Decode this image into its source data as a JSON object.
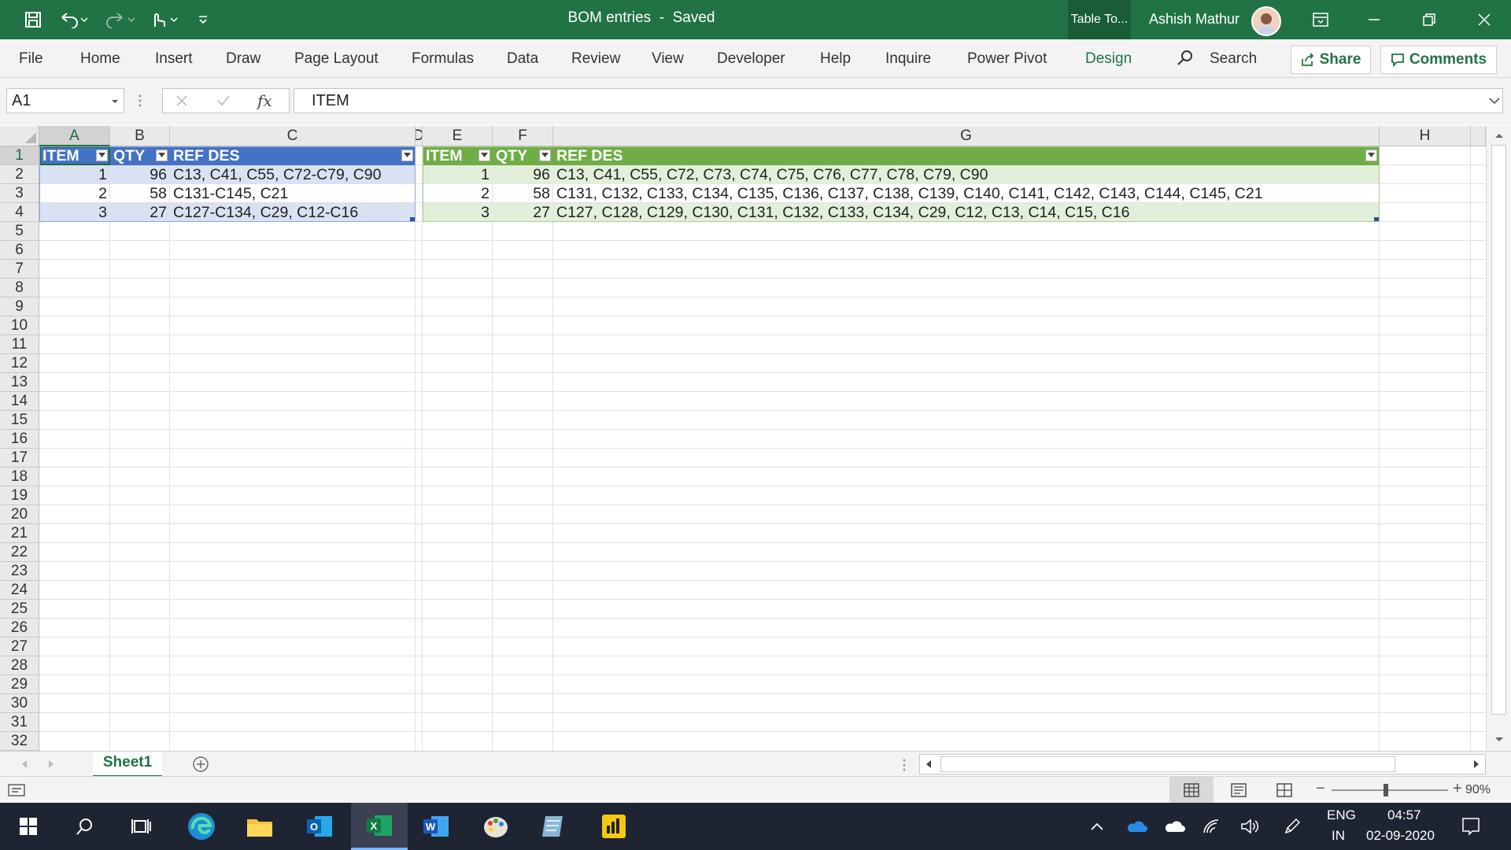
{
  "titlebar": {
    "doc_title": "BOM entries  -  Saved",
    "table_tools": "Table To...",
    "user_name": "Ashish Mathur"
  },
  "ribbon": {
    "tabs": [
      "File",
      "Home",
      "Insert",
      "Draw",
      "Page Layout",
      "Formulas",
      "Data",
      "Review",
      "View",
      "Developer",
      "Help",
      "Inquire",
      "Power Pivot",
      "Design"
    ],
    "search_label": "Search",
    "share_label": "Share",
    "comments_label": "Comments"
  },
  "formula_bar": {
    "name_box": "A1",
    "formula": "ITEM"
  },
  "columns": [
    "A",
    "B",
    "C",
    "D",
    "E",
    "F",
    "G",
    "H"
  ],
  "rows": [
    "1",
    "2",
    "3",
    "4",
    "5",
    "6",
    "7",
    "8",
    "9",
    "10",
    "11",
    "12",
    "13",
    "14",
    "15",
    "16",
    "17",
    "18",
    "19",
    "20",
    "21",
    "22",
    "23",
    "24",
    "25",
    "26",
    "27",
    "28",
    "29",
    "30",
    "31",
    "32"
  ],
  "table1": {
    "headers": [
      "ITEM",
      "QTY",
      "REF DES"
    ],
    "rows": [
      [
        "1",
        "96",
        "C13, C41, C55, C72-C79, C90"
      ],
      [
        "2",
        "58",
        "C131-C145, C21"
      ],
      [
        "3",
        "27",
        "C127-C134, C29, C12-C16"
      ]
    ]
  },
  "table2": {
    "headers": [
      "ITEM",
      "QTY",
      "REF DES"
    ],
    "rows": [
      [
        "1",
        "96",
        "C13, C41, C55, C72, C73, C74, C75, C76, C77, C78, C79, C90"
      ],
      [
        "2",
        "58",
        "C131, C132, C133, C134, C135, C136, C137, C138, C139, C140, C141, C142, C143, C144, C145, C21"
      ],
      [
        "3",
        "27",
        "C127, C128, C129, C130, C131, C132, C133, C134, C29, C12, C13, C14, C15, C16"
      ]
    ]
  },
  "sheet_tabs": [
    "Sheet1"
  ],
  "status": {
    "zoom": "90%"
  },
  "taskbar": {
    "lang1": "ENG",
    "lang2": "IN",
    "time": "04:57",
    "date": "02-09-2020"
  },
  "colors": {
    "excel_green": "#217346",
    "table1_header": "#4472c4",
    "table2_header": "#70ad47"
  }
}
